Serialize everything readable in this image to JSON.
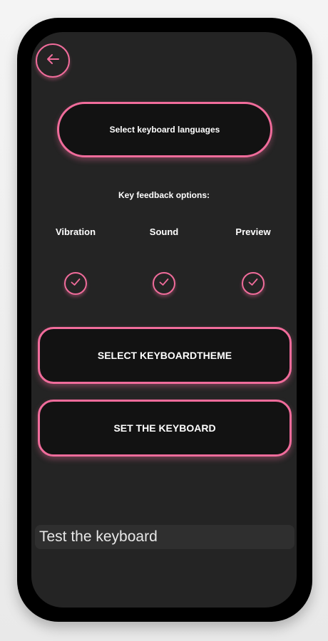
{
  "header": {
    "back_icon": "arrow-left-icon"
  },
  "languages_button": {
    "label": "Select keyboard languages"
  },
  "feedback": {
    "title": "Key feedback options:",
    "options": [
      {
        "label": "Vibration",
        "checked": true
      },
      {
        "label": "Sound",
        "checked": true
      },
      {
        "label": "Preview",
        "checked": true
      }
    ]
  },
  "theme_button": {
    "label": "SELECT KEYBOARDTHEME"
  },
  "set_button": {
    "label": "SET THE KEYBOARD"
  },
  "test_input": {
    "placeholder": "Test the keyboard",
    "value": ""
  },
  "colors": {
    "accent": "#f06c9b",
    "background": "#242424",
    "button_fill": "#121212"
  }
}
